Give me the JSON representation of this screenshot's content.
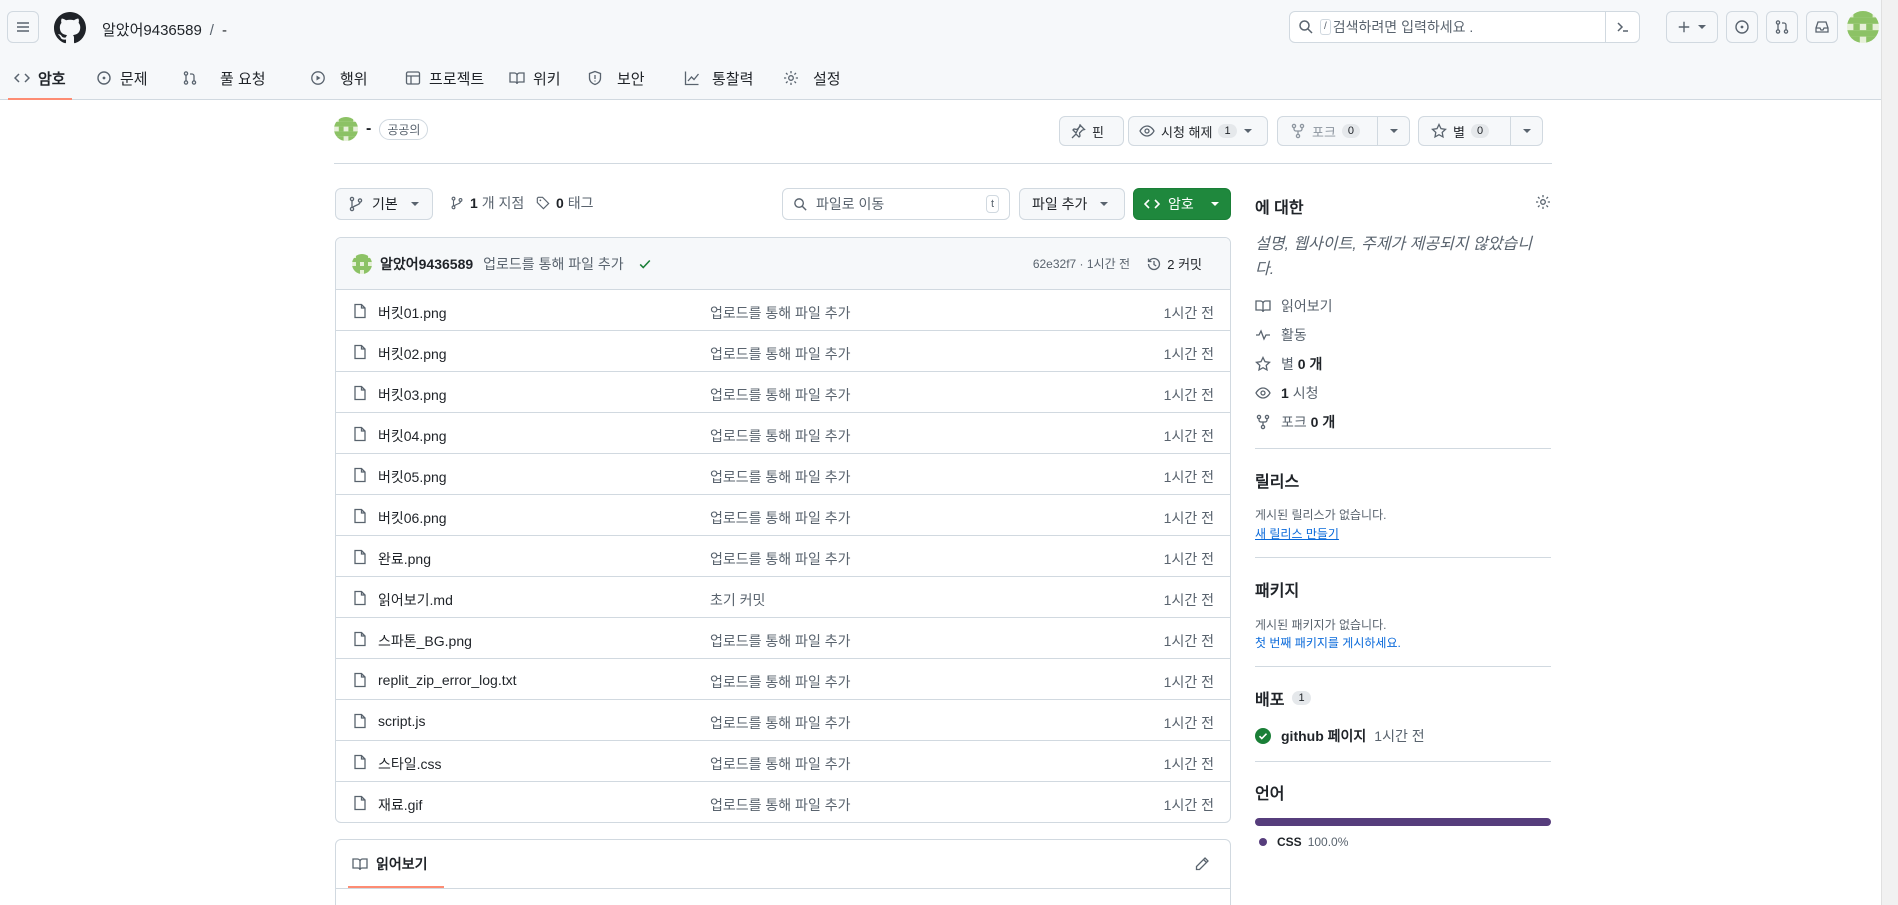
{
  "header": {
    "owner": "알았어9436589",
    "repo": "-",
    "search_placeholder": "검색하려면 입력하세요 ."
  },
  "tabs": [
    {
      "label": "암호",
      "icon": "code-icon"
    },
    {
      "label": "문제",
      "icon": "issue-icon"
    },
    {
      "label": "풀 요청",
      "icon": "pull-request-icon"
    },
    {
      "label": "행위",
      "icon": "play-icon"
    },
    {
      "label": "프로젝트",
      "icon": "table-icon"
    },
    {
      "label": "위키",
      "icon": "book-icon"
    },
    {
      "label": "보안",
      "icon": "shield-icon"
    },
    {
      "label": "통찰력",
      "icon": "graph-icon"
    },
    {
      "label": "설정",
      "icon": "gear-icon"
    }
  ],
  "repo_head": {
    "name": "-",
    "visibility": "공공의",
    "pin_label": "핀",
    "watch_label": "시청 해제",
    "watch_count": "1",
    "fork_label": "포크",
    "fork_count": "0",
    "star_label": "별",
    "star_count": "0"
  },
  "file_nav": {
    "branch": "기본",
    "branch_count": "1",
    "branch_label": "개 지점",
    "tag_count": "0",
    "tag_label": "태그",
    "goto_placeholder": "파일로 이동",
    "goto_key": "t",
    "add_file": "파일 추가",
    "code_button": "암호"
  },
  "commit": {
    "author": "알았어9436589",
    "message": "업로드를 통해 파일 추가",
    "sha_time": "62e32f7 · 1시간 전",
    "history": "2 커밋"
  },
  "files": [
    {
      "name": "버킷01.png",
      "message": "업로드를 통해 파일 추가",
      "time": "1시간 전"
    },
    {
      "name": "버킷02.png",
      "message": "업로드를 통해 파일 추가",
      "time": "1시간 전"
    },
    {
      "name": "버킷03.png",
      "message": "업로드를 통해 파일 추가",
      "time": "1시간 전"
    },
    {
      "name": "버킷04.png",
      "message": "업로드를 통해 파일 추가",
      "time": "1시간 전"
    },
    {
      "name": "버킷05.png",
      "message": "업로드를 통해 파일 추가",
      "time": "1시간 전"
    },
    {
      "name": "버킷06.png",
      "message": "업로드를 통해 파일 추가",
      "time": "1시간 전"
    },
    {
      "name": "완료.png",
      "message": "업로드를 통해 파일 추가",
      "time": "1시간 전"
    },
    {
      "name": "읽어보기.md",
      "message": "초기 커밋",
      "time": "1시간 전"
    },
    {
      "name": "스파톤_BG.png",
      "message": "업로드를 통해 파일 추가",
      "time": "1시간 전"
    },
    {
      "name": "replit_zip_error_log.txt",
      "message": "업로드를 통해 파일 추가",
      "time": "1시간 전"
    },
    {
      "name": "script.js",
      "message": "업로드를 통해 파일 추가",
      "time": "1시간 전"
    },
    {
      "name": "스타일.css",
      "message": "업로드를 통해 파일 추가",
      "time": "1시간 전"
    },
    {
      "name": "재료.gif",
      "message": "업로드를 통해 파일 추가",
      "time": "1시간 전"
    }
  ],
  "readme": {
    "tab_label": "읽어보기"
  },
  "sidebar": {
    "about_title": "에 대한",
    "about_desc": "설명, 웹사이트, 주제가 제공되지 않았습니다.",
    "readme": "읽어보기",
    "activity": "활동",
    "stars_label": "별",
    "stars_value": "0 개",
    "watch_value": "1",
    "watch_label": "시청",
    "forks_label": "포크",
    "forks_value": "0 개",
    "releases_title": "릴리스",
    "releases_none": "게시된 릴리스가 없습니다.",
    "releases_link": "새 릴리스 만들기",
    "packages_title": "패키지",
    "packages_none": "게시된 패키지가 없습니다.",
    "packages_link": "첫 번째 패키지를 게시하세요.",
    "deploy_title": "배포",
    "deploy_count": "1",
    "deploy_name": "github 페이지",
    "deploy_time": "1시간 전",
    "lang_title": "언어",
    "lang_name": "CSS",
    "lang_pct": "100.0%",
    "lang_color": "#563d7c"
  },
  "colors": {
    "accent_green": "#1f883d",
    "tab_underline": "#fd8c73",
    "link_blue": "#0969da"
  }
}
